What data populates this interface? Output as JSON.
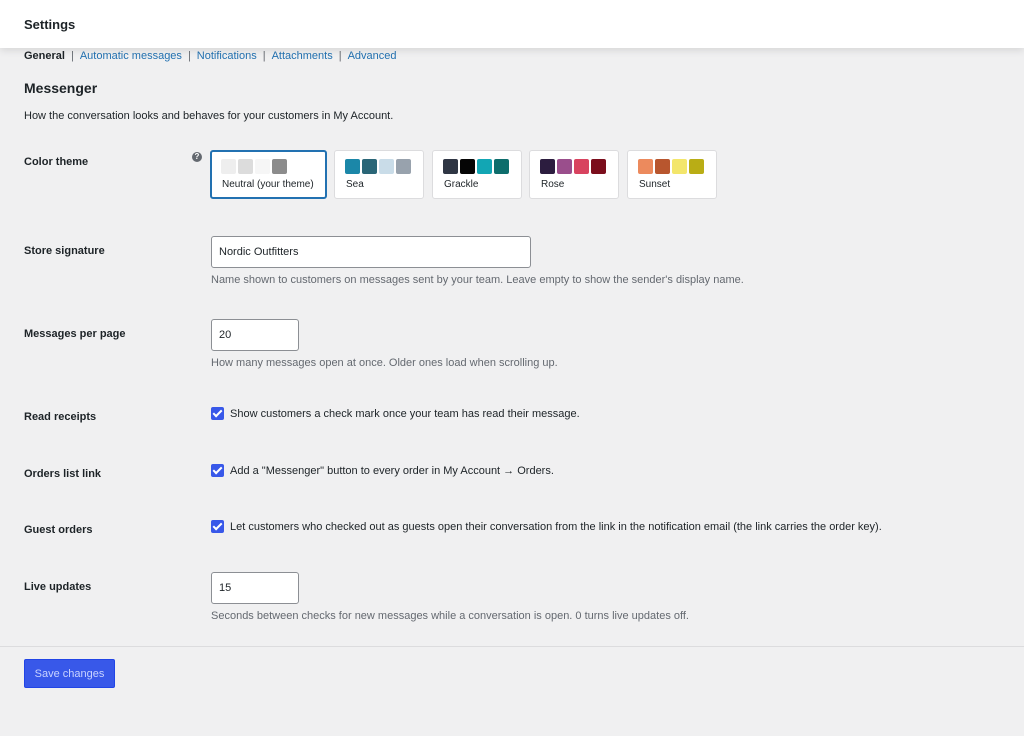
{
  "header": {
    "title": "Settings"
  },
  "subnav": {
    "current": "General",
    "links": [
      "Automatic messages",
      "Notifications",
      "Attachments",
      "Advanced"
    ],
    "separator": "|"
  },
  "section": {
    "title": "Messenger",
    "description": "How the conversation looks and behaves for your customers in My Account."
  },
  "color_theme": {
    "label": "Color theme",
    "help_glyph": "?",
    "selected": "Neutral (your theme)",
    "options": [
      {
        "name": "Neutral (your theme)",
        "colors": [
          "#eeeeee",
          "#dcdcdc",
          "#f6f6f6",
          "#8c8c8c"
        ]
      },
      {
        "name": "Sea",
        "colors": [
          "#1b87a8",
          "#2a6677",
          "#c9dce8",
          "#98a2ad"
        ]
      },
      {
        "name": "Grackle",
        "colors": [
          "#2f3644",
          "#050505",
          "#12a6b4",
          "#0d6d6c"
        ]
      },
      {
        "name": "Rose",
        "colors": [
          "#2c1d3f",
          "#9a4e8c",
          "#d8435f",
          "#7b0d1c"
        ]
      },
      {
        "name": "Sunset",
        "colors": [
          "#ec8a5d",
          "#b8562e",
          "#f3e66b",
          "#b9ad15"
        ]
      }
    ]
  },
  "store_signature": {
    "label": "Store signature",
    "value": "Nordic Outfitters",
    "hint": "Name shown to customers on messages sent by your team. Leave empty to show the sender's display name."
  },
  "messages_per_page": {
    "label": "Messages per page",
    "value": "20",
    "hint": "How many messages open at once. Older ones load when scrolling up."
  },
  "read_receipts": {
    "label": "Read receipts",
    "checked": true,
    "text": "Show customers a check mark once your team has read their message."
  },
  "orders_list_link": {
    "label": "Orders list link",
    "checked": true,
    "text": "Add a \"Messenger\" button to every order in My Account → Orders."
  },
  "guest_orders": {
    "label": "Guest orders",
    "checked": true,
    "text": "Let customers who checked out as guests open their conversation from the link in the notification email (the link carries the order key)."
  },
  "live_updates": {
    "label": "Live updates",
    "value": "15",
    "hint": "Seconds between checks for new messages while a conversation is open. 0 turns live updates off."
  },
  "save_button": {
    "label": "Save changes"
  },
  "colors": {
    "accent": "#3858e9",
    "link": "#2271b1",
    "selected_border": "#2271b1"
  }
}
